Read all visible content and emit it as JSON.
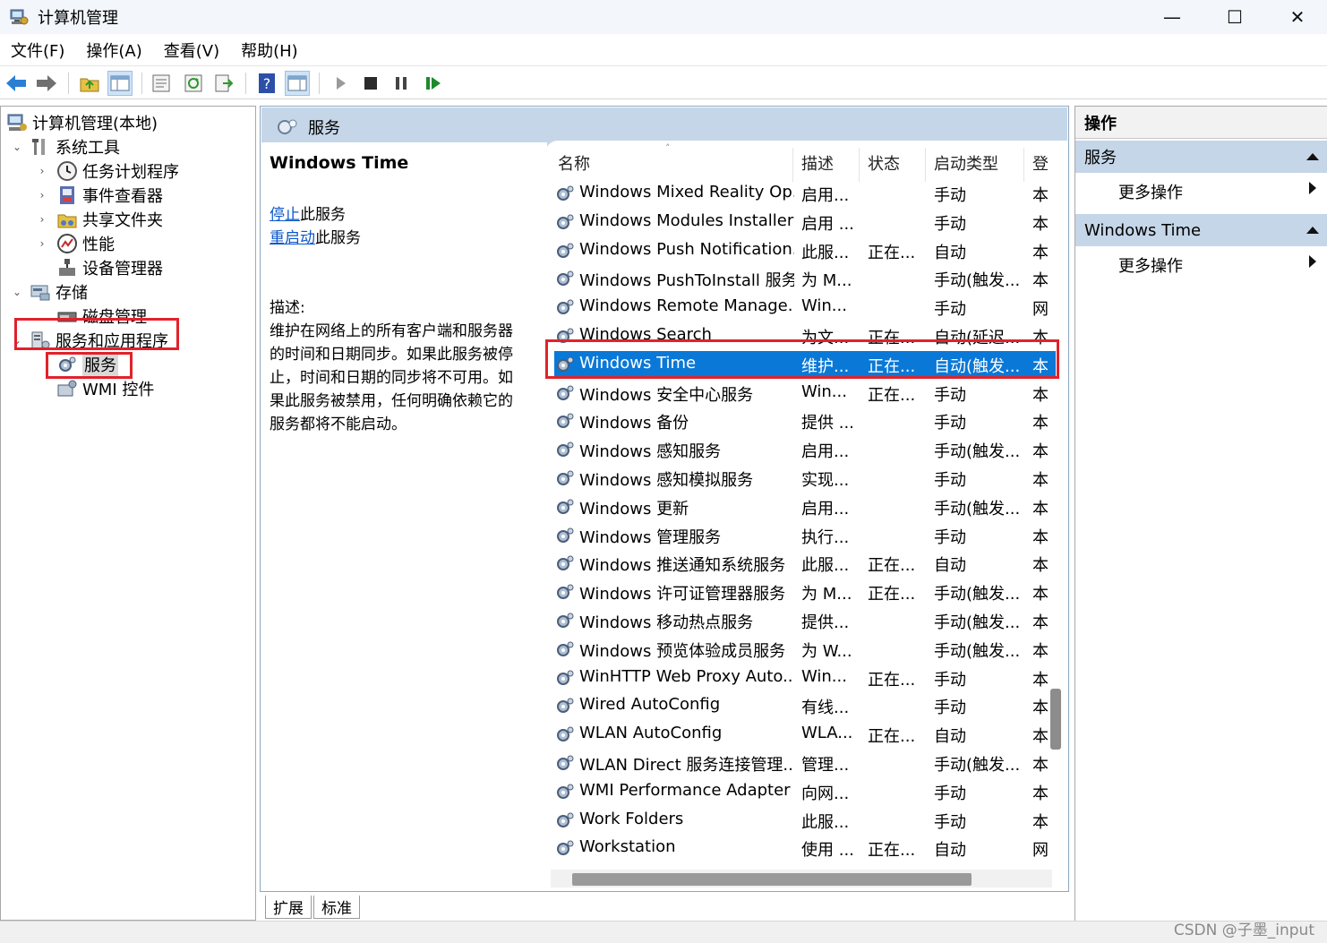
{
  "window": {
    "title": "计算机管理",
    "minimize_glyph": "—",
    "maximize_glyph": "☐",
    "close_glyph": "✕"
  },
  "menu": [
    "文件(F)",
    "操作(A)",
    "查看(V)",
    "帮助(H)"
  ],
  "toolbar": {
    "icons": [
      "back-arrow-icon",
      "forward-arrow-icon",
      "up-folder-icon",
      "show-hide-tree-icon",
      "properties-icon",
      "refresh-icon",
      "export-list-icon",
      "help-icon",
      "show-hide-action-pane-icon",
      "start-service-icon",
      "stop-service-icon",
      "pause-service-icon",
      "resume-service-icon"
    ]
  },
  "tree": {
    "root": "计算机管理(本地)",
    "system_tools": "系统工具",
    "task_scheduler": "任务计划程序",
    "event_viewer": "事件查看器",
    "shared_folders": "共享文件夹",
    "performance": "性能",
    "device_manager": "设备管理器",
    "storage": "存储",
    "disk_management": "磁盘管理",
    "services_apps": "服务和应用程序",
    "services": "服务",
    "wmi": "WMI 控件"
  },
  "middle": {
    "header": "服务",
    "selected_service": "Windows Time",
    "stop_link": "停止",
    "stop_suffix": "此服务",
    "restart_link": "重启动",
    "restart_suffix": "此服务",
    "desc_label": "描述:",
    "desc_lines": [
      "维护在网络上的所有客户端和服务器",
      "的时间和日期同步。如果此服务被停",
      "止，时间和日期的同步将不可用。如",
      "果此服务被禁用，任何明确依赖它的",
      "服务都将不能启动。"
    ]
  },
  "list": {
    "columns": {
      "name": "名称",
      "desc": "描述",
      "status": "状态",
      "startup": "启动类型",
      "logon": "登"
    },
    "rows": [
      {
        "name": "Windows Mixed Reality Op...",
        "desc": "启用...",
        "status": "",
        "startup": "手动",
        "logon": "本"
      },
      {
        "name": "Windows Modules Installer",
        "desc": "启用 ...",
        "status": "",
        "startup": "手动",
        "logon": "本"
      },
      {
        "name": "Windows Push Notification...",
        "desc": "此服...",
        "status": "正在...",
        "startup": "自动",
        "logon": "本"
      },
      {
        "name": "Windows PushToInstall 服务",
        "desc": "为 M...",
        "status": "",
        "startup": "手动(触发...",
        "logon": "本"
      },
      {
        "name": "Windows Remote Manage...",
        "desc": "Win...",
        "status": "",
        "startup": "手动",
        "logon": "网"
      },
      {
        "name": "Windows Search",
        "desc": "为文...",
        "status": "正在...",
        "startup": "自动(延迟...",
        "logon": "本"
      },
      {
        "name": "Windows Time",
        "desc": "维护...",
        "status": "正在...",
        "startup": "自动(触发...",
        "logon": "本"
      },
      {
        "name": "Windows 安全中心服务",
        "desc": "Win...",
        "status": "正在...",
        "startup": "手动",
        "logon": "本"
      },
      {
        "name": "Windows 备份",
        "desc": "提供 ...",
        "status": "",
        "startup": "手动",
        "logon": "本"
      },
      {
        "name": "Windows 感知服务",
        "desc": "启用...",
        "status": "",
        "startup": "手动(触发...",
        "logon": "本"
      },
      {
        "name": "Windows 感知模拟服务",
        "desc": "实现...",
        "status": "",
        "startup": "手动",
        "logon": "本"
      },
      {
        "name": "Windows 更新",
        "desc": "启用...",
        "status": "",
        "startup": "手动(触发...",
        "logon": "本"
      },
      {
        "name": "Windows 管理服务",
        "desc": "执行...",
        "status": "",
        "startup": "手动",
        "logon": "本"
      },
      {
        "name": "Windows 推送通知系统服务",
        "desc": "此服...",
        "status": "正在...",
        "startup": "自动",
        "logon": "本"
      },
      {
        "name": "Windows 许可证管理器服务",
        "desc": "为 M...",
        "status": "正在...",
        "startup": "手动(触发...",
        "logon": "本"
      },
      {
        "name": "Windows 移动热点服务",
        "desc": "提供...",
        "status": "",
        "startup": "手动(触发...",
        "logon": "本"
      },
      {
        "name": "Windows 预览体验成员服务",
        "desc": "为 W...",
        "status": "",
        "startup": "手动(触发...",
        "logon": "本"
      },
      {
        "name": "WinHTTP Web Proxy Auto...",
        "desc": "Win...",
        "status": "正在...",
        "startup": "手动",
        "logon": "本"
      },
      {
        "name": "Wired AutoConfig",
        "desc": "有线...",
        "status": "",
        "startup": "手动",
        "logon": "本"
      },
      {
        "name": "WLAN AutoConfig",
        "desc": "WLA...",
        "status": "正在...",
        "startup": "自动",
        "logon": "本"
      },
      {
        "name": "WLAN Direct 服务连接管理...",
        "desc": "管理...",
        "status": "",
        "startup": "手动(触发...",
        "logon": "本"
      },
      {
        "name": "WMI Performance Adapter",
        "desc": "向网...",
        "status": "",
        "startup": "手动",
        "logon": "本"
      },
      {
        "name": "Work Folders",
        "desc": "此服...",
        "status": "",
        "startup": "手动",
        "logon": "本"
      },
      {
        "name": "Workstation",
        "desc": "使用 ...",
        "status": "正在...",
        "startup": "自动",
        "logon": "网"
      }
    ]
  },
  "tabs": [
    "扩展",
    "标准"
  ],
  "actions": {
    "title": "操作",
    "group1": "服务",
    "group1_more": "更多操作",
    "group2": "Windows Time",
    "group2_more": "更多操作"
  },
  "watermark": "CSDN @子墨_input",
  "colors": {
    "selection": "#0a78d7",
    "highlight_box": "#e0222b",
    "pane_header": "#c5d6e8"
  }
}
